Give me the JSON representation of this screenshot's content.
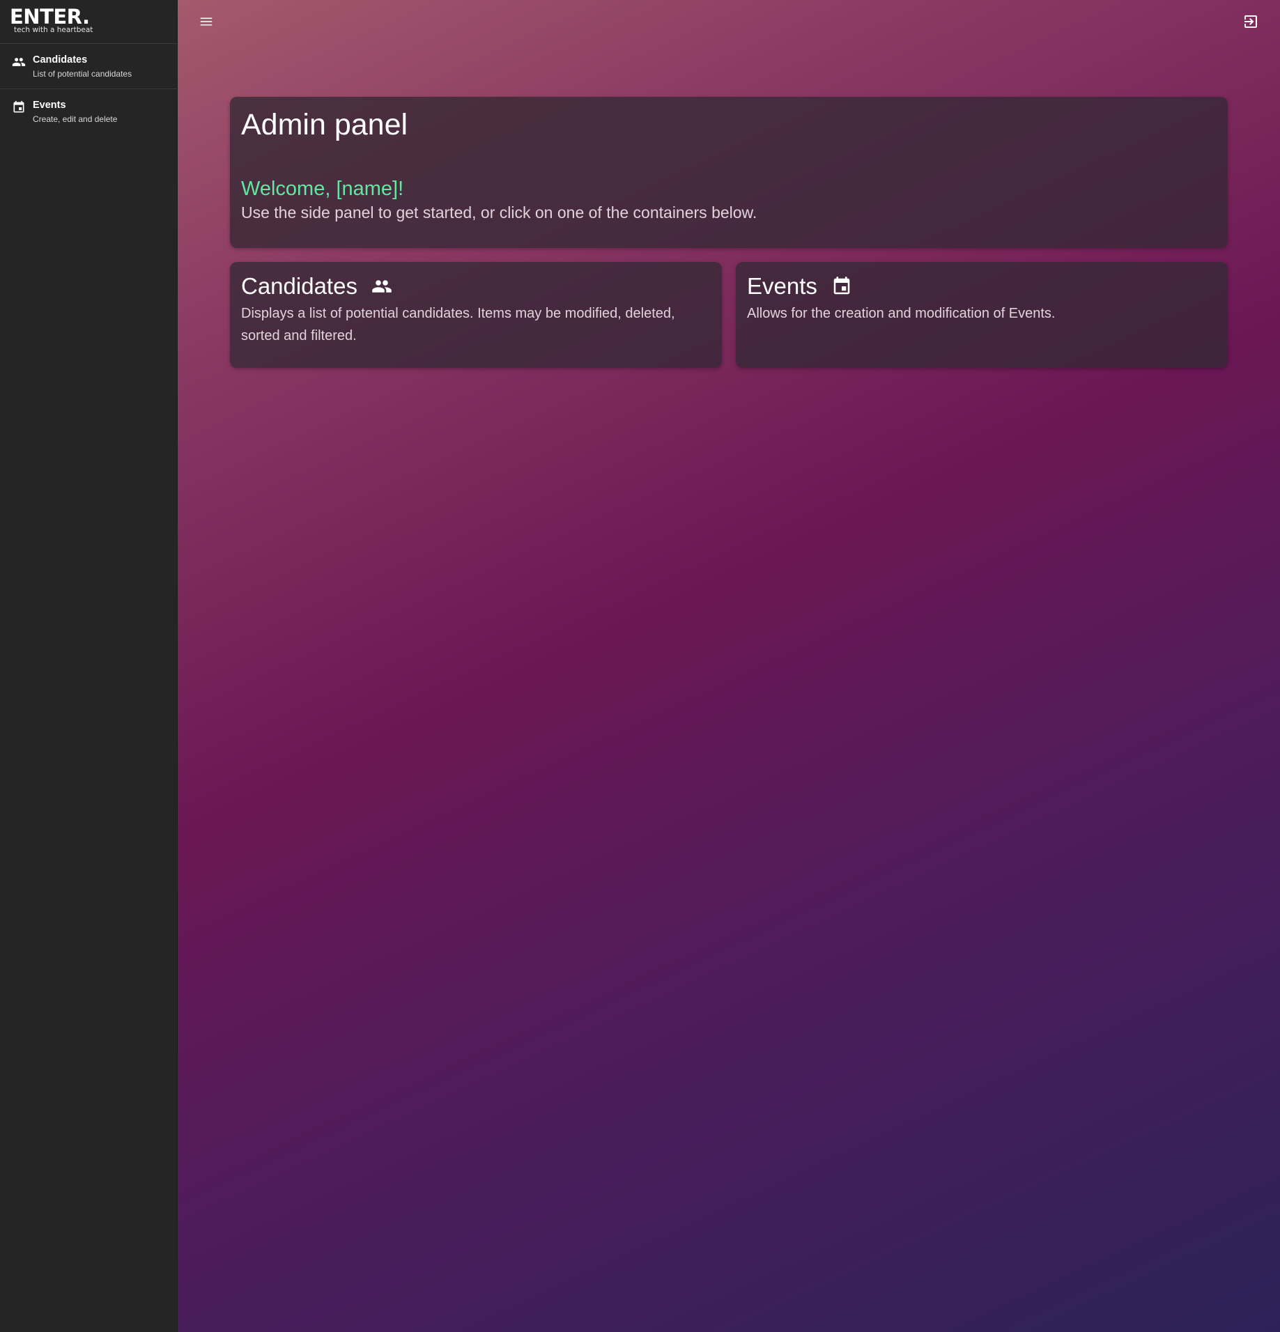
{
  "sidebar": {
    "logo": {
      "mark": "ENTER.",
      "tagline": "tech with a heartbeat"
    },
    "items": [
      {
        "title": "Candidates",
        "subtitle": "List of potential candidates",
        "icon": "people-icon"
      },
      {
        "title": "Events",
        "subtitle": "Create, edit and delete",
        "icon": "calendar-icon"
      }
    ]
  },
  "topbar": {
    "menu_icon": "hamburger-menu-icon",
    "logout_icon": "logout-icon"
  },
  "admin": {
    "title": "Admin panel",
    "welcome": "Welcome, [name]!",
    "description": "Use the side panel to get started, or click on one of the containers below."
  },
  "cards": [
    {
      "title": "Candidates",
      "icon": "people-icon",
      "description": "Displays a list of potential candidates. Items may be modified, deleted, sorted and filtered."
    },
    {
      "title": "Events",
      "icon": "calendar-icon",
      "description": "Allows for the creation and modification of Events."
    }
  ],
  "colors": {
    "sidebar_bg": "#252525",
    "welcome_accent": "#64e5a0",
    "card_bg": "#342834",
    "gradient_start": "#a45a6d",
    "gradient_mid": "#6b1754",
    "gradient_end": "#2c2259"
  }
}
